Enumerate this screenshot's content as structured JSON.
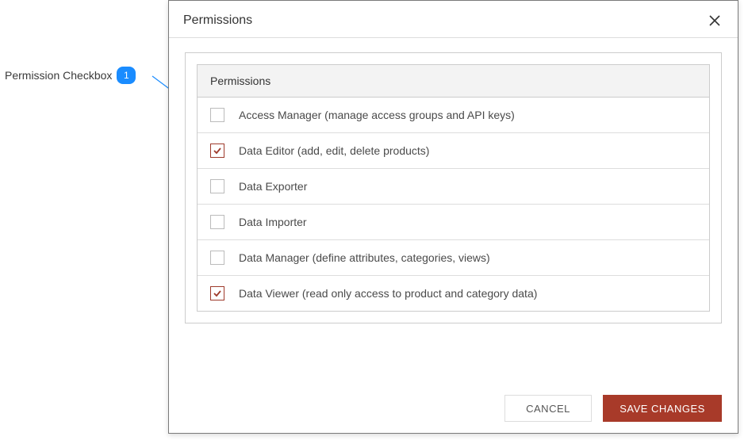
{
  "annotation": {
    "label": "Permission Checkbox",
    "number": "1"
  },
  "dialog": {
    "title": "Permissions"
  },
  "table": {
    "header": "Permissions",
    "rows": [
      {
        "checked": false,
        "label": "Access Manager (manage access groups and API keys)"
      },
      {
        "checked": true,
        "label": "Data Editor (add, edit, delete products)"
      },
      {
        "checked": false,
        "label": "Data Exporter"
      },
      {
        "checked": false,
        "label": "Data Importer"
      },
      {
        "checked": false,
        "label": "Data Manager (define attributes, categories, views)"
      },
      {
        "checked": true,
        "label": "Data Viewer (read only access to product and category data)"
      }
    ]
  },
  "buttons": {
    "cancel": "CANCEL",
    "save": "SAVE CHANGES"
  },
  "colors": {
    "primary": "#a83a29",
    "annotation": "#1a8cff"
  }
}
